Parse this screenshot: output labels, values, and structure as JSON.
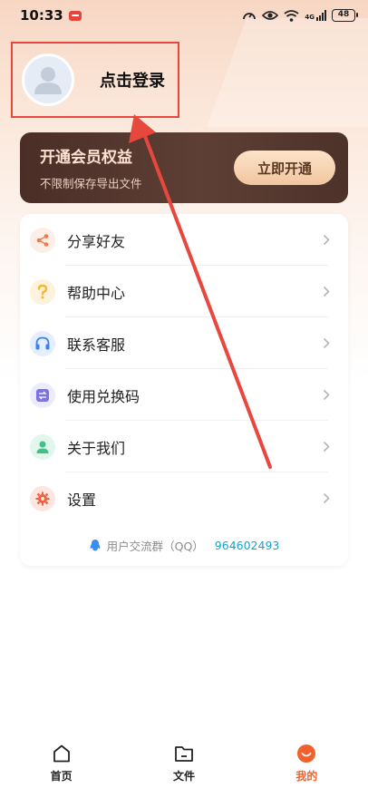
{
  "status_bar": {
    "time": "10:33",
    "network": "4G",
    "battery": "48"
  },
  "profile": {
    "login_label": "点击登录"
  },
  "vip": {
    "title": "开通会员权益",
    "subtitle": "不限制保存导出文件",
    "button_label": "立即开通"
  },
  "menu": {
    "items": [
      {
        "label": "分享好友",
        "icon": "share-icon",
        "color": "#f2794a",
        "bg": "#fdeee7"
      },
      {
        "label": "帮助中心",
        "icon": "question-icon",
        "color": "#f5b82e",
        "bg": "#fdf3dc"
      },
      {
        "label": "联系客服",
        "icon": "headset-icon",
        "color": "#3a82f0",
        "bg": "#e5eefc"
      },
      {
        "label": "使用兑换码",
        "icon": "exchange-icon",
        "color": "#7c72e8",
        "bg": "#ecebfc"
      },
      {
        "label": "关于我们",
        "icon": "person-icon",
        "color": "#3fc28a",
        "bg": "#e1f6ec"
      },
      {
        "label": "设置",
        "icon": "gear-icon",
        "color": "#f2613f",
        "bg": "#fde6df"
      }
    ]
  },
  "footer": {
    "qq_label": "用户交流群（QQ）",
    "qq_number": "964602493"
  },
  "bottom_nav": {
    "items": [
      {
        "label": "首页",
        "icon": "home-icon"
      },
      {
        "label": "文件",
        "icon": "folder-icon"
      },
      {
        "label": "我的",
        "icon": "profile-smile-icon",
        "active": true
      }
    ]
  },
  "colors": {
    "accent": "#f0612d",
    "annotation": "#e8473d",
    "vip_bg": "#4a2e27",
    "vip_button": "#f1c69f"
  }
}
